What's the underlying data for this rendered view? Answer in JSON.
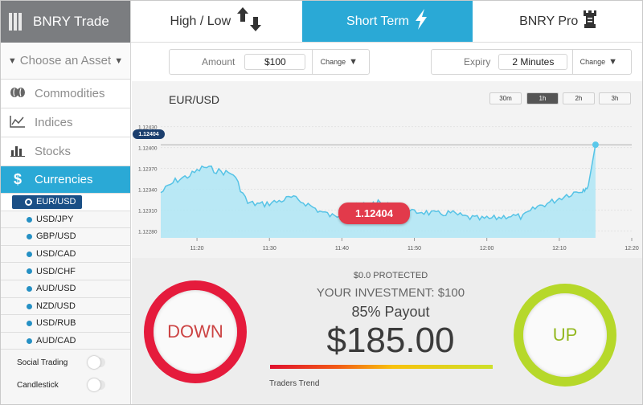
{
  "brand": {
    "name": "BNRY Trade"
  },
  "tabs": [
    {
      "label": "High / Low",
      "icon": "up-down-arrows-icon"
    },
    {
      "label": "Short Term",
      "icon": "lightning-icon"
    },
    {
      "label": "BNRY Pro",
      "icon": "rook-icon"
    }
  ],
  "sidebar": {
    "choose_label": "Choose an Asset",
    "categories": [
      {
        "label": "Commodities",
        "icon": "coffee-beans-icon"
      },
      {
        "label": "Indices",
        "icon": "line-chart-icon"
      },
      {
        "label": "Stocks",
        "icon": "bar-chart-icon"
      },
      {
        "label": "Currencies",
        "icon": "dollar-icon"
      }
    ],
    "assets": [
      "EUR/USD",
      "USD/JPY",
      "GBP/USD",
      "USD/CAD",
      "USD/CHF",
      "AUD/USD",
      "NZD/USD",
      "USD/RUB",
      "AUD/CAD"
    ],
    "selected_asset": "EUR/USD",
    "toggles": [
      {
        "label": "Social Trading",
        "on": false
      },
      {
        "label": "Candlestick",
        "on": false
      }
    ]
  },
  "controls": {
    "amount_label": "Amount",
    "amount_value": "$100",
    "expiry_label": "Expiry",
    "expiry_value": "2 Minutes",
    "change_label": "Change"
  },
  "chart": {
    "pair": "EUR/USD",
    "timeframes": [
      "30m",
      "1h",
      "2h",
      "3h"
    ],
    "active_timeframe": "1h",
    "current_price_tag": "1.12404",
    "current_price_bubble": "1.12404",
    "colors": {
      "area": "#a9e3f3",
      "line": "#5bc8ea",
      "bubble": "#e23a4b"
    }
  },
  "chart_data": {
    "type": "area",
    "title": "EUR/USD",
    "x_ticks": [
      "11:20",
      "11:30",
      "11:40",
      "11:50",
      "12:00",
      "12:10",
      "12:20"
    ],
    "y_ticks": [
      "1.12430",
      "1.12400",
      "1.12370",
      "1.12340",
      "1.12310",
      "1.12280"
    ],
    "ylim": [
      1.1227,
      1.1244
    ],
    "x": [
      "11:15",
      "11:17",
      "11:19",
      "11:21",
      "11:23",
      "11:25",
      "11:27",
      "11:29",
      "11:31",
      "11:33",
      "11:35",
      "11:37",
      "11:39",
      "11:41",
      "11:43",
      "11:45",
      "11:47",
      "11:49",
      "11:51",
      "11:53",
      "11:55",
      "11:57",
      "11:59",
      "12:01",
      "12:03",
      "12:05",
      "12:07",
      "12:09",
      "12:11",
      "12:13",
      "12:14",
      "12:15"
    ],
    "values": [
      1.12335,
      1.12352,
      1.1236,
      1.12372,
      1.12366,
      1.12362,
      1.1232,
      1.12318,
      1.12322,
      1.12328,
      1.1232,
      1.12308,
      1.123,
      1.12313,
      1.12318,
      1.1232,
      1.12315,
      1.12306,
      1.12308,
      1.12304,
      1.12306,
      1.123,
      1.12297,
      1.12298,
      1.12302,
      1.123,
      1.12315,
      1.12322,
      1.12332,
      1.12338,
      1.12345,
      1.12404
    ],
    "grid": true
  },
  "trade": {
    "protected": "$0.0 PROTECTED",
    "investment": "YOUR INVESTMENT: $100",
    "payout": "85% Payout",
    "amount": "$185.00",
    "down_label": "DOWN",
    "up_label": "UP",
    "trend_label": "Traders Trend"
  }
}
